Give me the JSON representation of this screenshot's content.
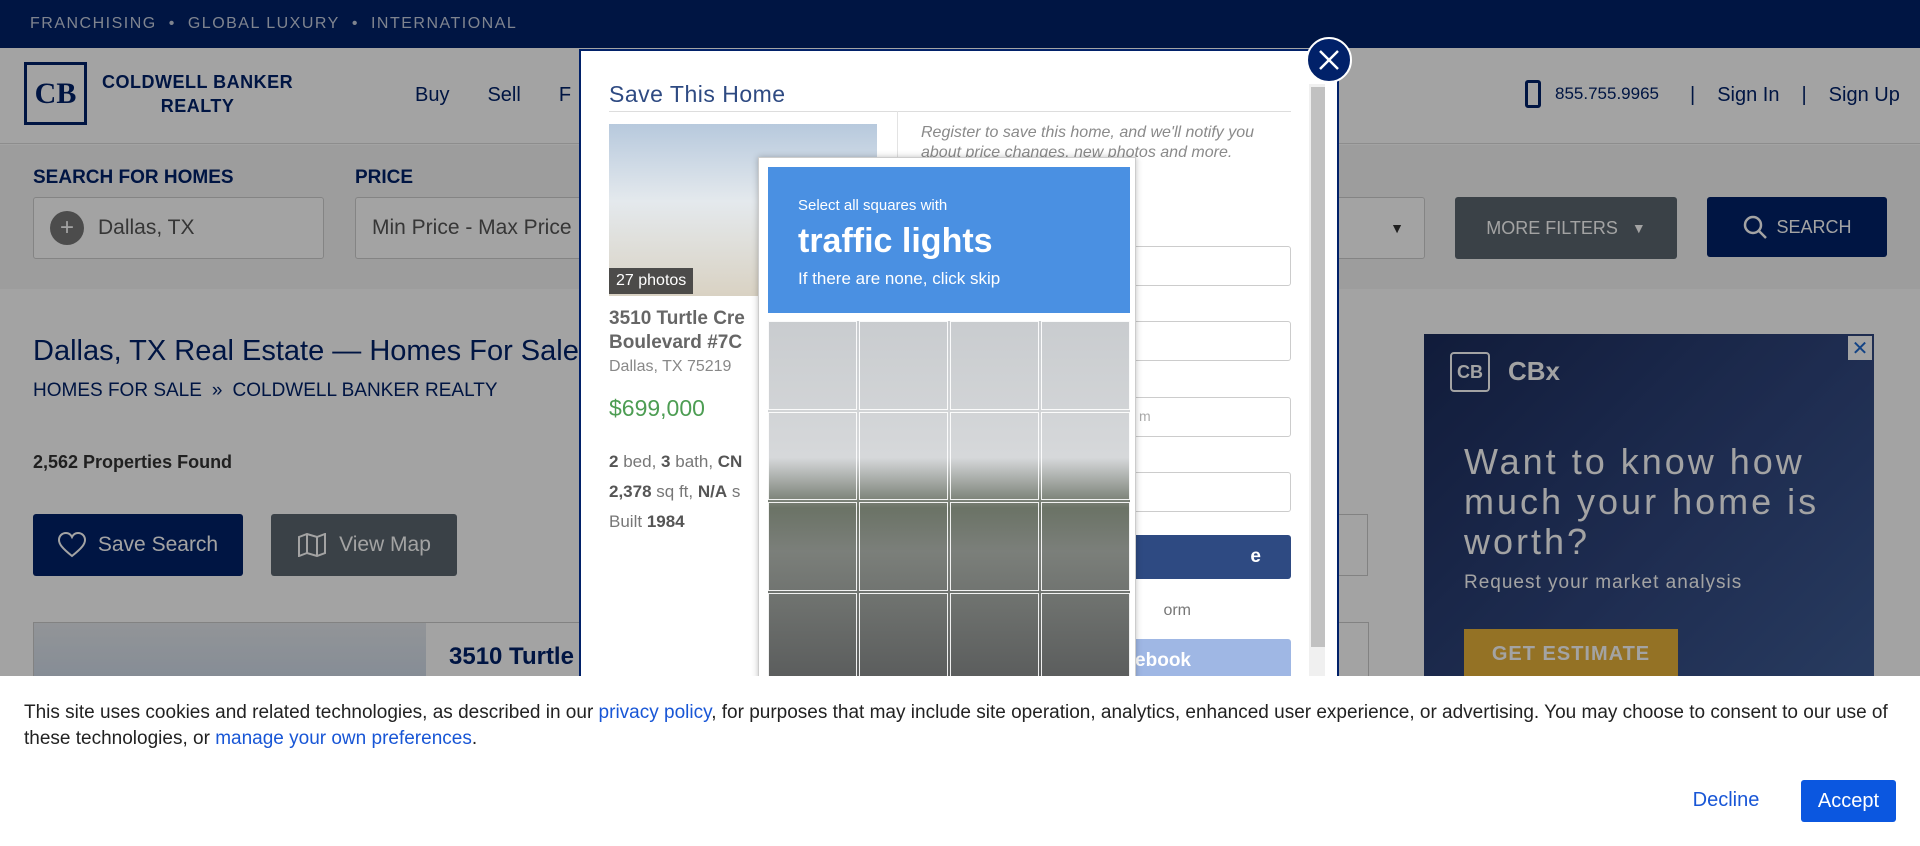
{
  "topbar": {
    "items": [
      "FRANCHISING",
      "GLOBAL LUXURY",
      "INTERNATIONAL"
    ]
  },
  "header": {
    "logo_letters": "CB",
    "logo_line1": "COLDWELL BANKER",
    "logo_line2": "REALTY",
    "nav": [
      "Buy",
      "Sell",
      "F"
    ],
    "phone": "855.755.9965",
    "sign_in": "Sign In",
    "sign_up": "Sign Up"
  },
  "search": {
    "search_label": "SEARCH FOR HOMES",
    "location_value": "Dallas, TX",
    "price_label": "PRICE",
    "price_value": "Min Price  -  Max Price",
    "more_filters": "MORE FILTERS",
    "search_button": "SEARCH"
  },
  "main": {
    "title": "Dallas, TX Real Estate — Homes For Sale",
    "breadcrumb_1": "HOMES FOR SALE",
    "breadcrumb_sep": "»",
    "breadcrumb_2": "COLDWELL BANKER REALTY",
    "count": "2,562 Properties Found",
    "save_search": "Save Search",
    "view_map": "View Map",
    "listing_title": "3510 Turtle"
  },
  "ad": {
    "brand": "CBx",
    "headline": "Want to know how much your home is worth?",
    "subline": "Request your market analysis",
    "button": "GET ESTIMATE"
  },
  "modal": {
    "title": "Save This Home",
    "photos": "27 photos",
    "address_line": "3510 Turtle Cre",
    "address_line2": "Boulevard #7C",
    "city": "Dallas, TX 75219",
    "price": "$699,000",
    "beds": "2",
    "beds_lbl": "bed,",
    "baths": "3",
    "baths_lbl": "bath,",
    "cn": "CN",
    "sqft": "2,378",
    "sqft_lbl": "sq ft,",
    "na": "N/A",
    "na_lbl": "s",
    "built_lbl": "Built",
    "built": "1984",
    "register": "Register to save this home, and we'll notify you about price changes, new photos and more.",
    "email_hint": "m",
    "button_suffix": "e",
    "or_text": "orm",
    "facebook": "acebook"
  },
  "captcha": {
    "line1": "Select all squares with",
    "line2": "traffic lights",
    "line3": "If there are none, click skip"
  },
  "cookie": {
    "text_1": "This site uses cookies and related technologies, as described in our ",
    "link_1": "privacy policy",
    "text_2": ", for purposes that may include site operation, analytics, enhanced user experience, or advertising. You may choose to consent to our use of these technologies, or ",
    "link_2": "manage your own preferences",
    "text_3": ".",
    "decline": "Decline",
    "accept": "Accept"
  }
}
